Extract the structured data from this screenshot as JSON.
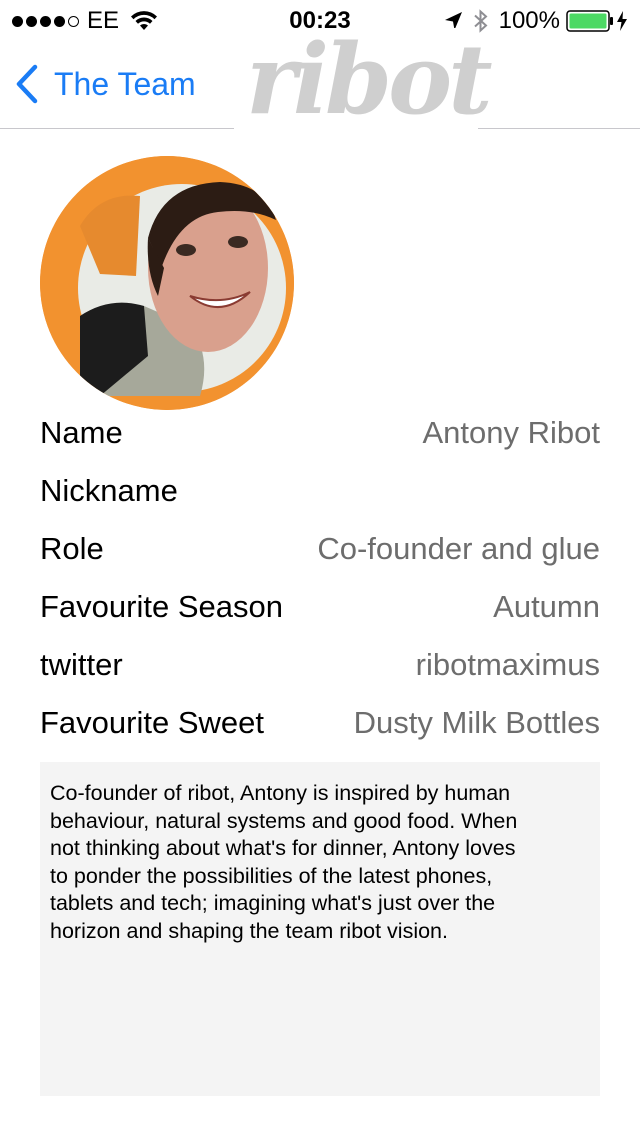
{
  "status_bar": {
    "carrier": "EE",
    "time": "00:23",
    "battery_percent": "100%",
    "signal_bars_filled": 4,
    "signal_bars_total": 5,
    "icons": [
      "wifi-icon",
      "location-arrow-icon",
      "bluetooth-icon",
      "battery-icon",
      "charging-bolt-icon"
    ]
  },
  "nav": {
    "back_label": "The Team",
    "logo_text": "ribot"
  },
  "profile": {
    "avatar_border_color": "#f2922f",
    "fields": [
      {
        "label": "Name",
        "value": "Antony Ribot"
      },
      {
        "label": "Nickname",
        "value": ""
      },
      {
        "label": "Role",
        "value": "Co-founder and glue"
      },
      {
        "label": "Favourite Season",
        "value": "Autumn"
      },
      {
        "label": "twitter",
        "value": "ribotmaximus"
      },
      {
        "label": "Favourite Sweet",
        "value": "Dusty Milk Bottles"
      }
    ],
    "bio_lines": [
      "Co-founder of ribot, Antony is inspired by human",
      "behaviour, natural systems and good food. When",
      "not thinking about what's for dinner, Antony loves",
      "to ponder the possibilities of the latest phones,",
      "tablets and tech; imagining what's just over the",
      "horizon and shaping the team ribot vision."
    ]
  },
  "colors": {
    "accent": "#1a7cf5",
    "battery": "#4cd964",
    "value_text": "#6d6d6d",
    "bio_background": "#f4f4f4"
  }
}
